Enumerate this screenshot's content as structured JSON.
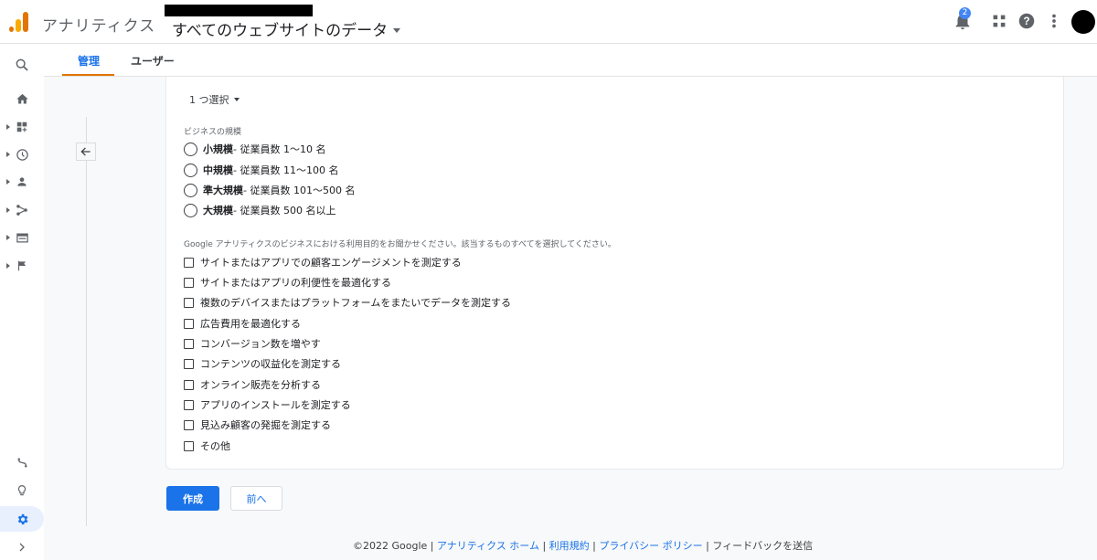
{
  "header": {
    "app_title": "アナリティクス",
    "property_label": "すべてのウェブサイトのデータ",
    "notification_count": "2"
  },
  "tabs": [
    {
      "label": "管理",
      "active": true
    },
    {
      "label": "ユーザー",
      "active": false
    }
  ],
  "rail_icons": [
    "search-icon",
    "home-icon",
    "customization-icon",
    "realtime-icon",
    "audience-icon",
    "acquisition-icon",
    "behavior-icon",
    "conversions-icon",
    "attribution-icon",
    "lightbulb-icon",
    "settings-icon",
    "expand-icon"
  ],
  "form": {
    "select_label": "1 つ選択",
    "business_size_label": "ビジネスの規模",
    "business_sizes": [
      {
        "bold": "小規模",
        "detail": " - 従業員数 1〜10 名"
      },
      {
        "bold": "中規模",
        "detail": " - 従業員数 11〜100 名"
      },
      {
        "bold": "準大規模",
        "detail": " - 従業員数 101〜500 名"
      },
      {
        "bold": "大規模",
        "detail": " - 従業員数 500 名以上"
      }
    ],
    "purpose_label": "Google アナリティクスのビジネスにおける利用目的をお聞かせください。該当するものすべてを選択してください。",
    "purposes": [
      "サイトまたはアプリでの顧客エンゲージメントを測定する",
      "サイトまたはアプリの利便性を最適化する",
      "複数のデバイスまたはプラットフォームをまたいでデータを測定する",
      "広告費用を最適化する",
      "コンバージョン数を増やす",
      "コンテンツの収益化を測定する",
      "オンライン販売を分析する",
      "アプリのインストールを測定する",
      "見込み顧客の発掘を測定する",
      "その他"
    ]
  },
  "buttons": {
    "create": "作成",
    "prev": "前へ"
  },
  "footer": {
    "copyright": "©2022 Google",
    "home_link": "アナリティクス ホーム",
    "terms_link": "利用規約",
    "privacy_link": "プライバシー ポリシー",
    "feedback": "フィードバックを送信"
  },
  "colors": {
    "accent": "#1a73e8",
    "tab_underline": "#e37400",
    "logo_orange": "#e37400",
    "logo_yellow": "#f9ab00"
  }
}
